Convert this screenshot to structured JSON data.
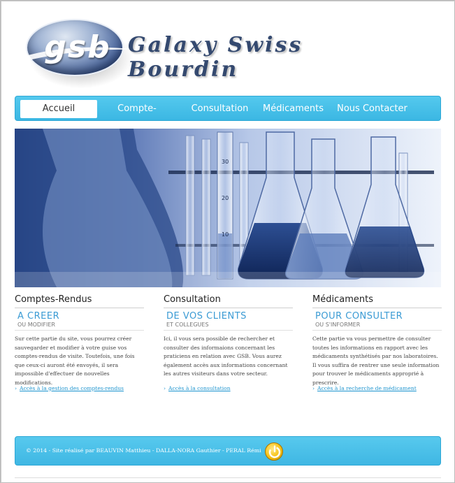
{
  "brand": {
    "logo_mark": "gsb",
    "title": "Galaxy Swiss Bourdin"
  },
  "nav": {
    "items": [
      {
        "label": "Accueil",
        "active": true
      },
      {
        "label": "Compte-Rendus",
        "active": false
      },
      {
        "label": "Consultation",
        "active": false
      },
      {
        "label": "Médicaments",
        "active": false
      },
      {
        "label": "Nous Contacter",
        "active": false
      }
    ]
  },
  "hero": {
    "scale_labels": [
      "30",
      "20",
      "10"
    ]
  },
  "sections": [
    {
      "title": "Comptes-Rendus",
      "subtitle": "A CREER",
      "caption": "OU MODIFIER",
      "text": "Sur cette partie du site, vous pourrez créer sauvegarder et modifier à votre guise vos comptes-rendus de visite. Toutefois, une fois que ceux-ci auront été envoyés, il sera impossible d'effectuer de nouvelles modifications.",
      "link": "Accès à la gestion des comptes-rendus"
    },
    {
      "title": "Consultation",
      "subtitle": "DE VOS CLIENTS",
      "caption": "ET COLLEGUES",
      "text": "Ici, il vous sera possible de rechercher et consulter des informaions concernant les praticiens en relation avec GSB. Vous aurez également accès aux informations concernant les autres visiteurs dans votre secteur.",
      "link": "Accès à la consultation"
    },
    {
      "title": "Médicaments",
      "subtitle": "POUR CONSULTER",
      "caption": "OU S'INFORMER",
      "text": "Cette partie va vous permettre de consulter toutes les informations en rapport avec les médicaments synthétisés par nos laboratoires. Il vous suffira de rentrer une seule information pour trouver le médicaments approprié à prescrire.",
      "link": "Accès à la recherche de médicament"
    }
  ],
  "footer": {
    "text": "© 2014 - Site réalisé par   BEAUVIN Matthieu - DALLA-NORA Gauthier - PERAL Rémi",
    "icon": "power-icon"
  },
  "colors": {
    "accent": "#3bb7e3",
    "link": "#1f95cf",
    "subtitle": "#3b9bd4",
    "logo_text": "#34496f"
  }
}
